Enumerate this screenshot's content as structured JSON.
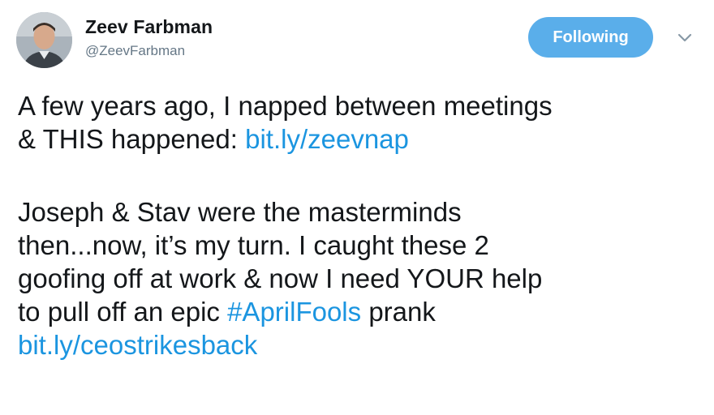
{
  "tweet": {
    "author": {
      "display_name": "Zeev Farbman",
      "handle": "@ZeevFarbman",
      "avatar_icon": "profile-photo"
    },
    "follow_button_label": "Following",
    "menu_icon": "chevron-down-icon",
    "paragraph1": {
      "line1": "A few years ago, I napped between meetings",
      "line2_text": "& THIS happened: ",
      "line2_link": "bit.ly/zeevnap"
    },
    "paragraph2": {
      "line1": "Joseph & Stav were the masterminds",
      "line2": "then...now, it’s my turn. I caught these 2",
      "line3": "goofing off at work & now I need YOUR help",
      "line4_text_before": "to pull off an epic ",
      "line4_hashtag": "#AprilFools",
      "line4_text_after": " prank",
      "line5_link": "bit.ly/ceostrikesback"
    },
    "colors": {
      "link": "#1b95e0",
      "button": "#5aaeea",
      "text": "#14171a",
      "muted": "#657786"
    }
  }
}
